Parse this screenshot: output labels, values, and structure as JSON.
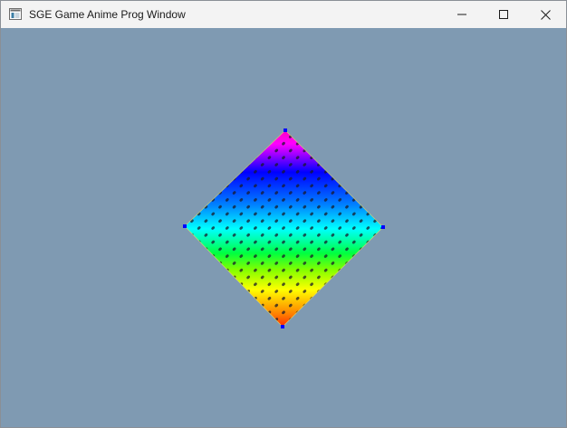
{
  "window": {
    "title": "SGE Game Anime Prog Window",
    "icons": {
      "app": "app-window-icon",
      "minimize": "minimize-icon",
      "maximize": "maximize-icon",
      "close": "close-icon"
    }
  },
  "client": {
    "background_color": "#7f9ab2",
    "sprite": {
      "description_shape": "diamond",
      "gradient_colors": [
        "#ff00c8",
        "#ff00ff",
        "#0000ff",
        "#0080ff",
        "#00ffff",
        "#00ff40",
        "#80ff00",
        "#ffff00",
        "#ff8000",
        "#ff2000"
      ],
      "marker_color": "#0000ff",
      "pattern": "dot-grid"
    }
  }
}
